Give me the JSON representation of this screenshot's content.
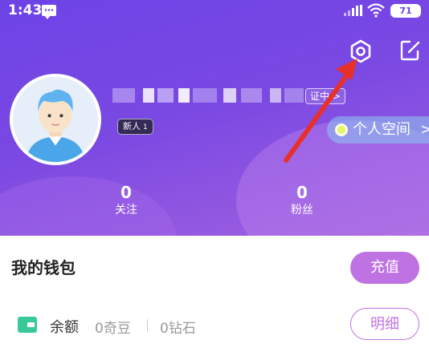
{
  "status_bar": {
    "time": "1:43",
    "battery": "71",
    "icons": [
      "message-icon",
      "signal-icon",
      "wifi-icon",
      "battery-icon"
    ]
  },
  "header": {
    "icons": [
      "settings-icon",
      "edit-icon"
    ],
    "verify_tag": "证中 >",
    "badge_new": "新人",
    "badge_level": "1",
    "space_button": "个人空间",
    "space_arrow": ">",
    "stats": [
      {
        "value": "0",
        "label": "关注"
      },
      {
        "value": "0",
        "label": "粉丝"
      }
    ]
  },
  "wallet": {
    "title": "我的钱包",
    "recharge_label": "充值",
    "balance_label": "余额",
    "qidou": "0奇豆",
    "diamond": "0钻石",
    "detail_label": "明细"
  },
  "colors": {
    "header_gradient_start": "#6d43e6",
    "header_gradient_end": "#a262de",
    "accent": "#bf73e3",
    "wallet_icon": "#38c99a",
    "annotation_arrow": "#e8302a"
  }
}
